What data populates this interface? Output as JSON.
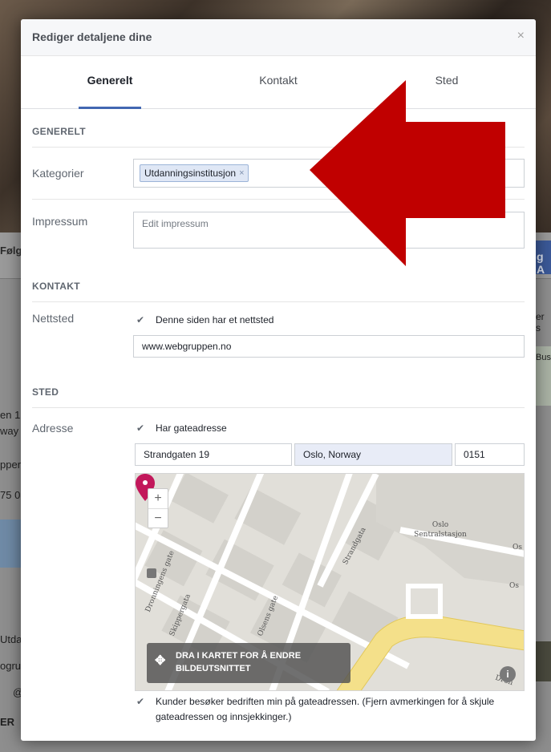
{
  "modal": {
    "title": "Rediger detaljene dine",
    "close": "×"
  },
  "tabs": [
    {
      "label": "Generelt",
      "active": true
    },
    {
      "label": "Kontakt",
      "active": false
    },
    {
      "label": "Sted",
      "active": false
    }
  ],
  "general": {
    "section_title": "GENERELT",
    "categories_label": "Kategorier",
    "category_token": "Utdanningsinstitusjon",
    "token_remove": "×",
    "impressum_label": "Impressum",
    "impressum_placeholder": "Edit impressum"
  },
  "contact": {
    "section_title": "KONTAKT",
    "website_label": "Nettsted",
    "has_website": "Denne siden har et nettsted",
    "website_value": "www.webgruppen.no"
  },
  "location": {
    "section_title": "STED",
    "address_label": "Adresse",
    "has_street_address": "Har gateadresse",
    "street": "Strandgaten 19",
    "city": "Oslo, Norway",
    "postal": "0151",
    "map_tip": "DRA I KARTET FOR Å ENDRE BILDEUTSNITTET",
    "zoom_in": "+",
    "zoom_out": "−",
    "map_labels": {
      "station": "Oslo\nSentralstasjon",
      "dronningens": "Dronningens gate",
      "skippergata": "Skippergata",
      "olsens": "Olsens gate",
      "strandgata": "Strandgata",
      "os": "Os",
      "dron": "Dron"
    },
    "info": "i",
    "visitors_text": "Kunder besøker bedriften min på gateadressen. (Fjern avmerkingen for å skjule gateadressen og innsjekkinger.)"
  },
  "background": {
    "follow_fragment": "Følg",
    "right_fragment": "g A",
    "frag_1": "en 1",
    "frag_2": "way",
    "frag_3": "pper",
    "frag_4": "75 0",
    "frag_5": "Utda",
    "frag_6": "ogru",
    "frag_7": "@",
    "frag_8": "ER",
    "frag_r1": "er s",
    "frag_r2": "Bus"
  },
  "colors": {
    "accent": "#4267b2",
    "arrow": "#c00000",
    "pin": "#c2185b",
    "map_road_major": "#f4e08a"
  }
}
